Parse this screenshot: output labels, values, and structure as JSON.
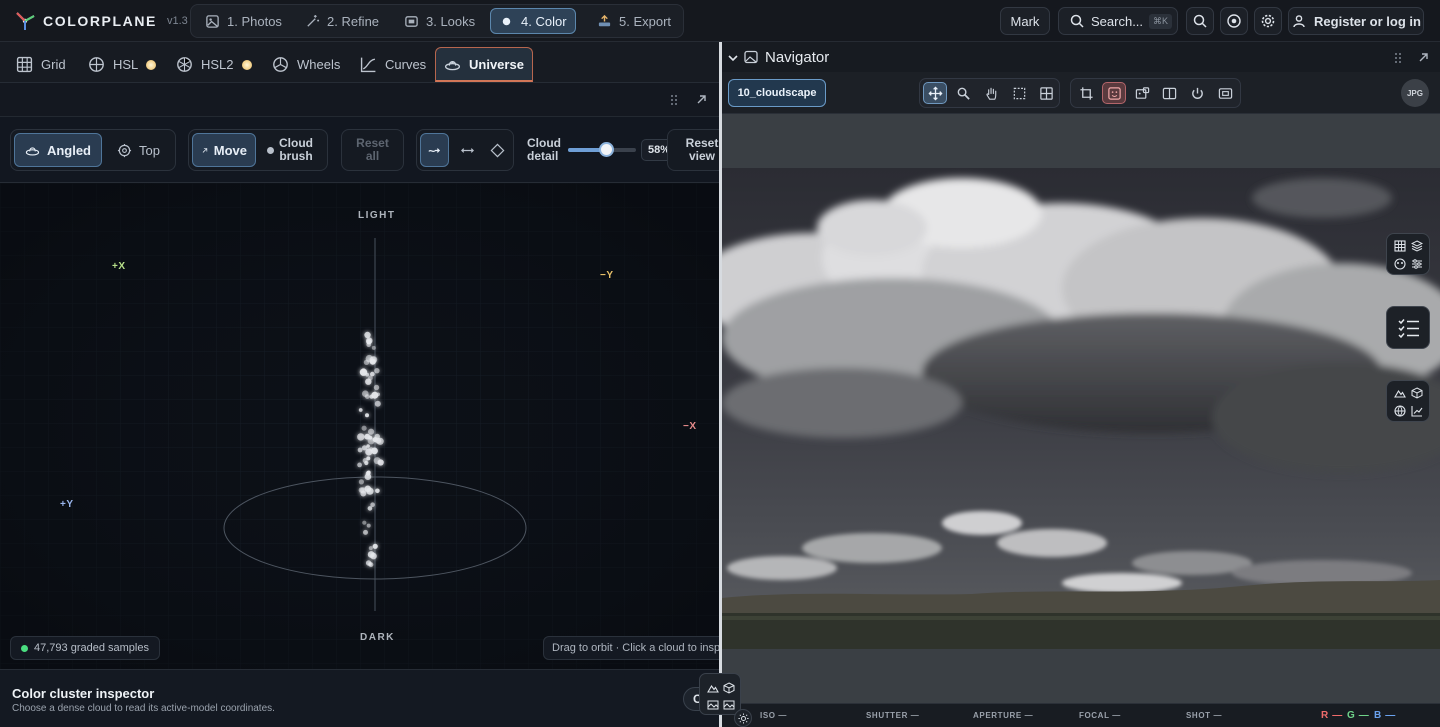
{
  "app": {
    "name": "COLORPLANE",
    "version": "v1.3"
  },
  "steps": [
    {
      "label": "1. Photos",
      "icon": "image-icon"
    },
    {
      "label": "2. Refine",
      "icon": "wand-icon"
    },
    {
      "label": "3. Looks",
      "icon": "looks-icon"
    },
    {
      "label": "4. Color",
      "icon": "dot-icon",
      "active": true
    },
    {
      "label": "5. Export",
      "icon": "export-icon"
    }
  ],
  "topbar": {
    "mark": "Mark",
    "search": "Search...",
    "search_kbd": "⌘K",
    "register": "Register or log in"
  },
  "tabs": [
    {
      "label": "Grid"
    },
    {
      "label": "HSL"
    },
    {
      "label": "HSL2"
    },
    {
      "label": "Wheels"
    },
    {
      "label": "Curves"
    },
    {
      "label": "Universe",
      "active": true
    }
  ],
  "toolbar": {
    "angled": "Angled",
    "top": "Top",
    "move": "Move",
    "cloud_brush_1": "Cloud",
    "cloud_brush_2": "brush",
    "reset_all_1": "Reset",
    "reset_all_2": "all",
    "cloud_detail_1": "Cloud",
    "cloud_detail_2": "detail",
    "cloud_detail_value": "58%",
    "cloud_detail_fraction": 0.58,
    "reset_view_1": "Reset",
    "reset_view_2": "view"
  },
  "viz": {
    "light": "LIGHT",
    "dark": "DARK",
    "plus_x": "+X",
    "minus_y": "−Y",
    "minus_x": "−X",
    "plus_y": "+Y",
    "samples": "47,793 graded samples",
    "hint": "Drag to orbit · Click a cloud to inspect"
  },
  "inspector": {
    "title": "Color cluster inspector",
    "subtitle": "Choose a dense cloud to read its active-model coordinates.",
    "btn_fragment": "C"
  },
  "navigator": {
    "title": "Navigator",
    "file": "10_cloudscape",
    "format": "JPG"
  },
  "status": {
    "iso": "ISO —",
    "shutter": "SHUTTER —",
    "aperture": "APERTURE —",
    "focal": "FOCAL —",
    "shot": "SHOT —",
    "r": "R —",
    "g": "G —",
    "b": "B —"
  },
  "colors": {
    "accent": "#d27657",
    "active_step": "#2e4257",
    "r": "#ef6b6b",
    "g": "#6fd38a",
    "b": "#6aa2ef"
  }
}
